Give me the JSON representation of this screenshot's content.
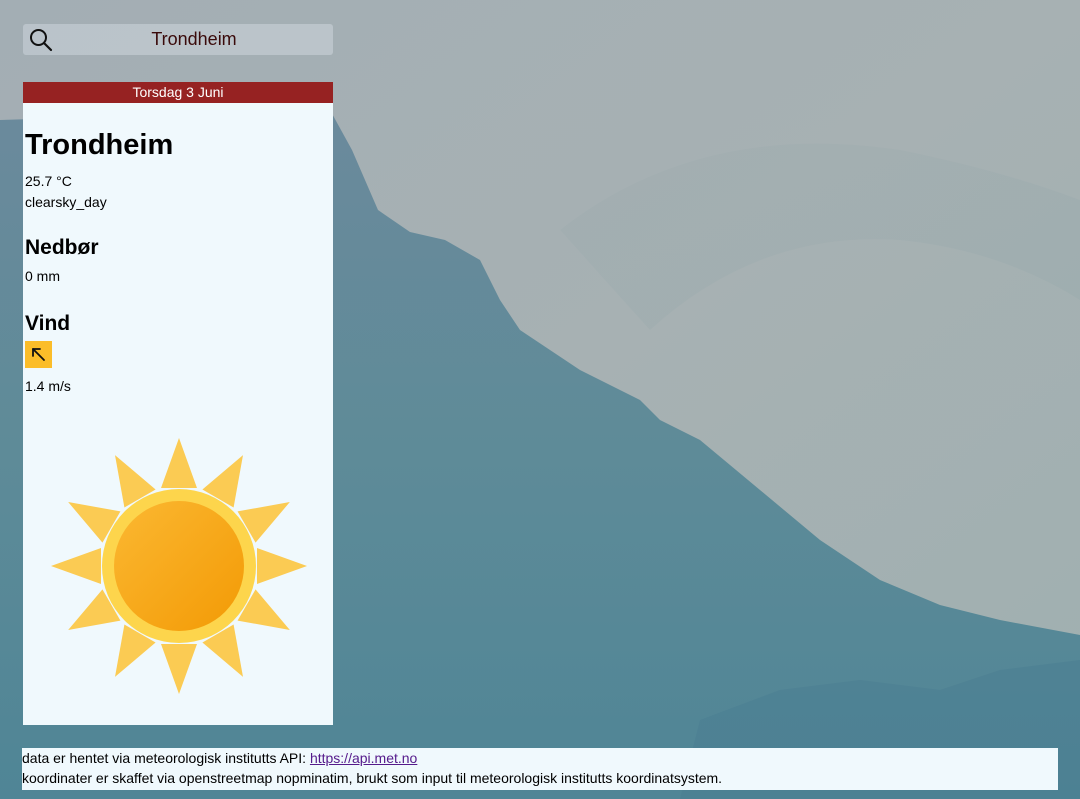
{
  "search": {
    "value": "Trondheim",
    "icon": "search-icon"
  },
  "card": {
    "date": "Torsdag 3 Juni",
    "city": "Trondheim",
    "temperature": "25.7 °C",
    "symbol": "clearsky_day",
    "precip_heading": "Nedbør",
    "precip_value": "0 mm",
    "wind_heading": "Vind",
    "wind_arrow_icon": "arrow-up-left-icon",
    "wind_speed": "1.4 m/s",
    "weather_icon": "sun-icon"
  },
  "footer": {
    "line1_text": "data er hentet via meteorologisk institutts API: ",
    "line1_link": "https://api.met.no",
    "line2_text": "koordinater er skaffet via openstreetmap nopminatim, brukt som input til meteorologisk institutts koordinatsystem."
  },
  "colors": {
    "date_bar": "#962222",
    "card_bg": "#f0f9fd",
    "wind_badge": "#fbbd29",
    "sun_core": "#f7a818",
    "sun_rays": "#fcc94a"
  }
}
